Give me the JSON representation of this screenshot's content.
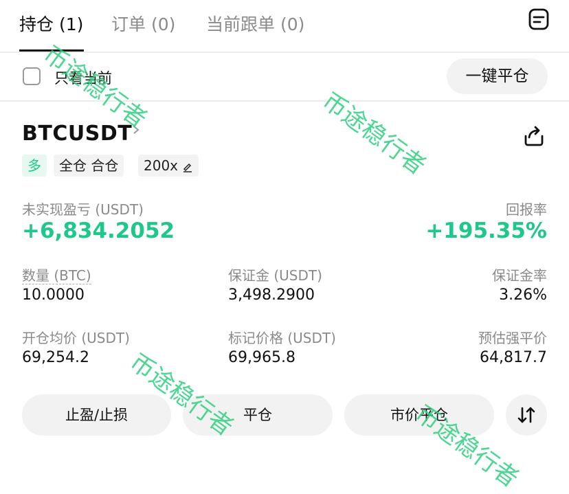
{
  "tabs": [
    {
      "label": "持仓 (1)",
      "active": true
    },
    {
      "label": "订单 (0)",
      "active": false
    },
    {
      "label": "当前跟单 (0)",
      "active": false
    }
  ],
  "filter": {
    "label": "只看当前",
    "checked": false
  },
  "close_all_label": "一键平仓",
  "position": {
    "symbol": "BTCUSDT",
    "badges": {
      "side": "多",
      "mode": "全仓 合仓",
      "leverage": "200x"
    },
    "unrealized_pnl": {
      "label": "未实现盈亏 (USDT)",
      "value": "+6,834.2052"
    },
    "roe": {
      "label": "回报率",
      "value": "+195.35%"
    },
    "quantity": {
      "label": "数量 (BTC)",
      "value": "10.0000"
    },
    "margin": {
      "label": "保证金 (USDT)",
      "value": "3,498.2900"
    },
    "margin_ratio": {
      "label": "保证金率",
      "value": "3.26%"
    },
    "entry_price": {
      "label": "开仓均价 (USDT)",
      "value": "69,254.2"
    },
    "mark_price": {
      "label": "标记价格 (USDT)",
      "value": "69,965.8"
    },
    "liq_price": {
      "label": "预估强平价",
      "value": "64,817.7"
    }
  },
  "actions": {
    "tp_sl": "止盈/止损",
    "close": "平仓",
    "market_close": "市价平仓"
  },
  "watermark": "币途稳行者",
  "colors": {
    "accent_green": "#1ec88a",
    "watermark_green": "#2fd07f"
  },
  "icons": [
    "document-icon",
    "chevron-right-icon",
    "share-icon",
    "edit-icon",
    "sort-icon"
  ]
}
